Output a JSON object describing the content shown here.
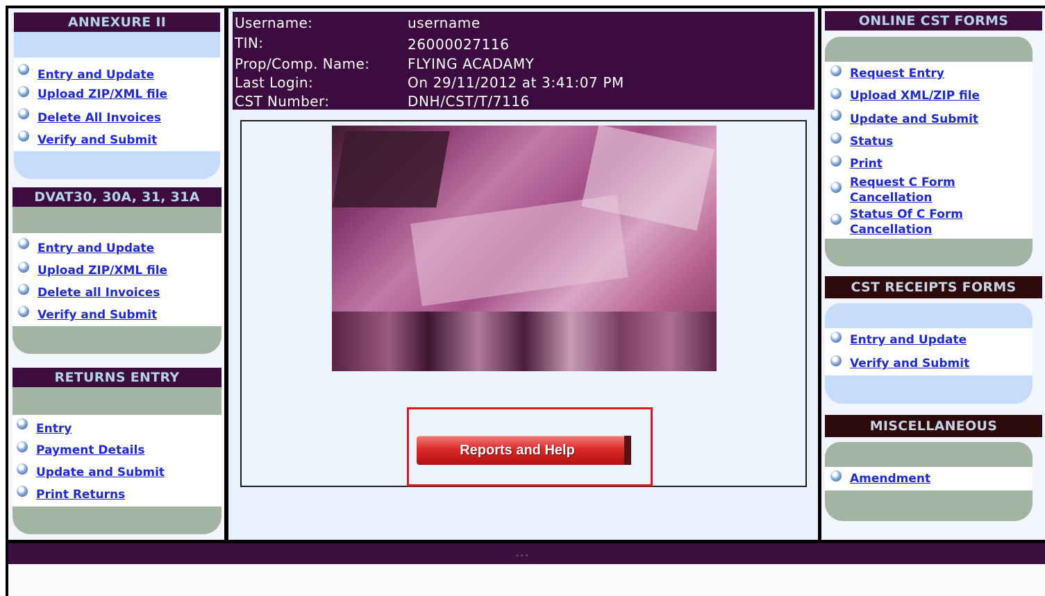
{
  "user_info": {
    "username_label": "Username:",
    "username": "username",
    "tin_label": "TIN:",
    "tin": "26000027116",
    "name_label": "Prop/Comp. Name:",
    "name": "FLYING ACADAMY",
    "last_login_label": "Last Login:",
    "last_login": "On 29/11/2012 at 3:41:07 PM",
    "cst_label": "CST Number:",
    "cst": "DNH/CST/T/7116"
  },
  "left": {
    "annexure": {
      "title": "ANNEXURE II",
      "links": [
        "Entry and Update",
        "Upload ZIP/XML file",
        "Delete All Invoices",
        "Verify and Submit"
      ]
    },
    "dvat": {
      "title": "DVAT30, 30A, 31, 31A",
      "links": [
        "Entry and Update",
        "Upload ZIP/XML file",
        "Delete all Invoices",
        "Verify and Submit"
      ]
    },
    "returns": {
      "title": "RETURNS ENTRY",
      "links": [
        "Entry",
        "Payment Details",
        "Update and Submit",
        "Print Returns"
      ]
    }
  },
  "right": {
    "online_cst": {
      "title": "ONLINE CST FORMS",
      "links": [
        "Request Entry",
        "Upload XML/ZIP file",
        "Update and Submit",
        "Status",
        "Print",
        "Request C Form",
        "Cancellation",
        "Status Of C Form",
        "Cancellation"
      ]
    },
    "cst_receipts": {
      "title": "CST RECEIPTS FORMS",
      "links": [
        "Entry and Update",
        "Verify and Submit"
      ]
    },
    "misc": {
      "title": "MISCELLANEOUS",
      "links": [
        "Amendment"
      ]
    }
  },
  "main": {
    "reports_button": "Reports and Help"
  },
  "colors": {
    "header_purple": "#3c0b3f",
    "link_blue": "#1f2bcf",
    "highlight_red": "#e4131b",
    "button_red": "#dc2b2b"
  }
}
